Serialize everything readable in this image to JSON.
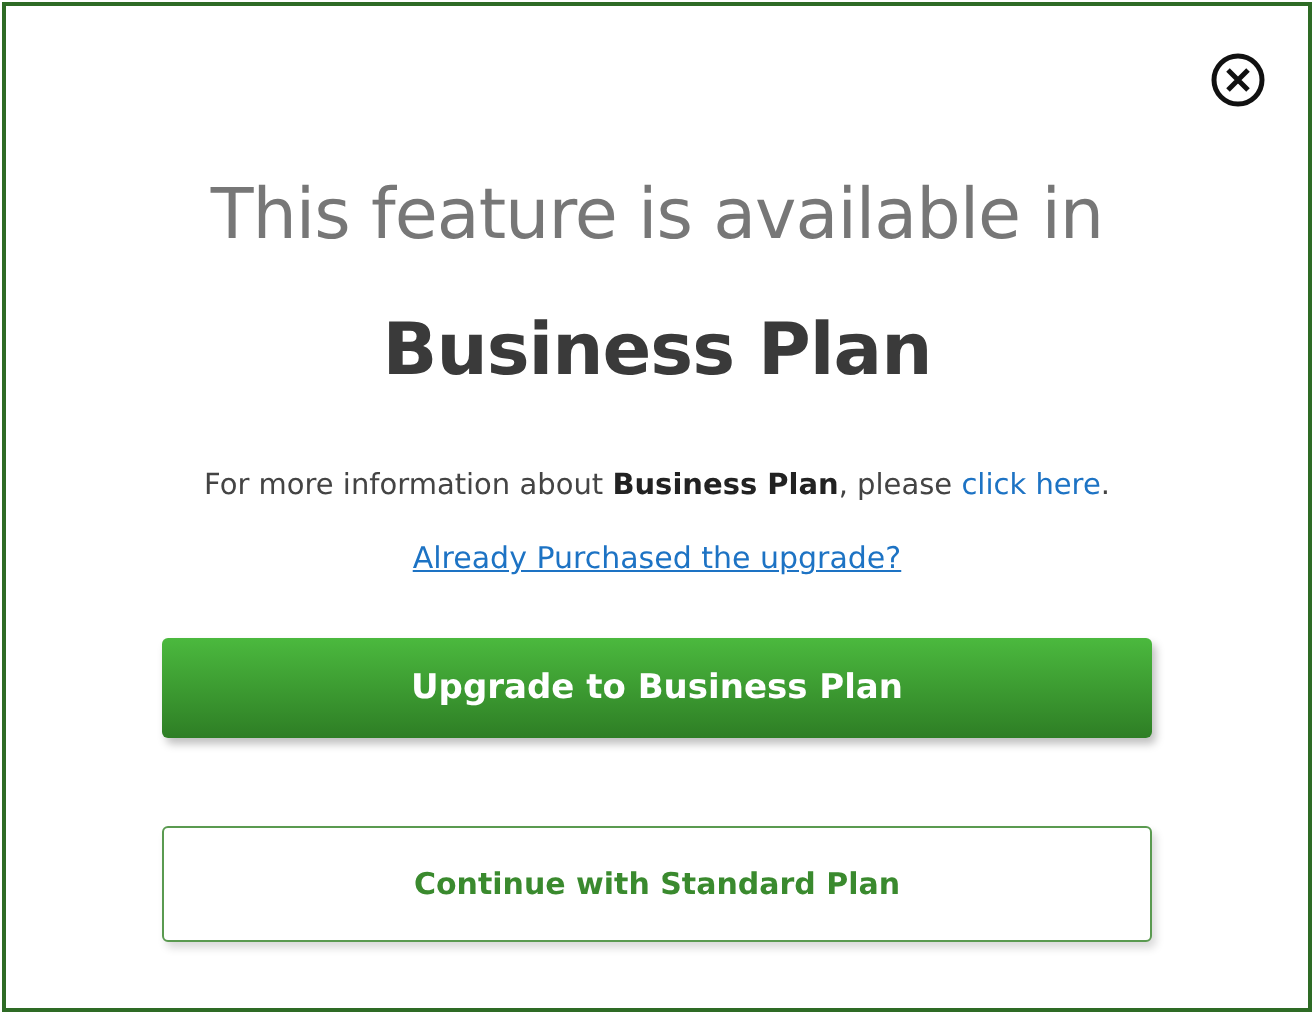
{
  "heading": "This feature is available in",
  "plan_name": "Business Plan",
  "info": {
    "text": "For more information about **Business Plan**, please ",
    "link": "click here",
    "suffix": "."
  },
  "purchased_link": "Already Purchased the upgrade?",
  "buttons": [
    {
      "label": "Upgrade to Business Plan",
      "kind": "primary"
    },
    {
      "label": "Continue with Standard Plan",
      "kind": "secondary"
    }
  ]
}
